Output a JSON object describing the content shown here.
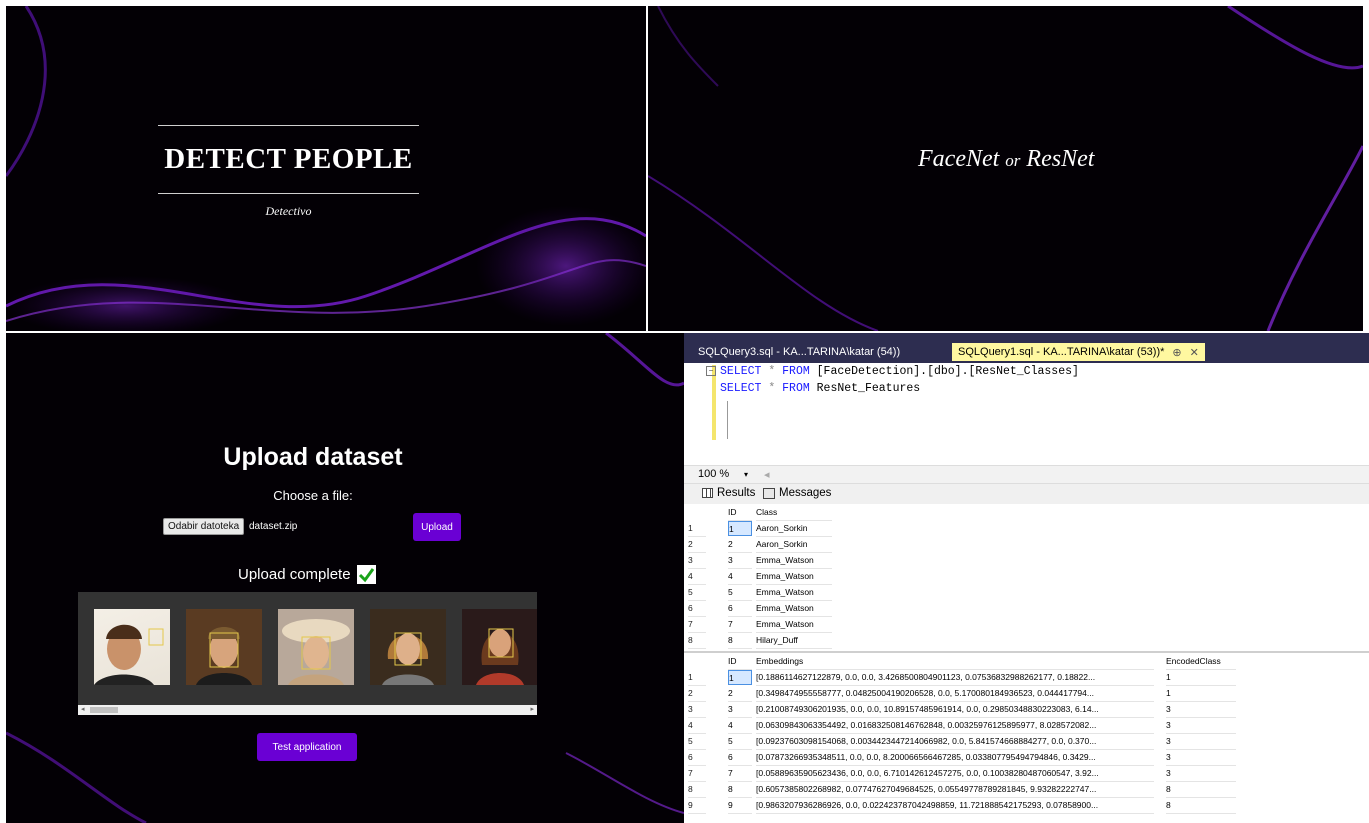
{
  "slide1": {
    "title": "DETECT PEOPLE",
    "subtitle": "Detectivo"
  },
  "slide2": {
    "title_part1": "FaceNet",
    "title_or": "or",
    "title_part2": "ResNet"
  },
  "upload": {
    "title": "Upload dataset",
    "choose_label": "Choose a file:",
    "file_button": "Odabir datoteka",
    "file_name": "dataset.zip",
    "upload_button": "Upload",
    "complete_text": "Upload complete",
    "test_button": "Test application",
    "faces": [
      "face-1",
      "face-2",
      "face-3",
      "face-4",
      "face-5"
    ]
  },
  "ssms": {
    "tab1": "SQLQuery3.sql - KA...TARINA\\katar (54))",
    "tab2": "SQLQuery1.sql - KA...TARINA\\katar (53))*",
    "tab2_pin": "⊕",
    "tab2_close": "✕",
    "code": {
      "line1_kw1": "SELECT",
      "line1_star": " * ",
      "line1_kw2": "FROM",
      "line1_rest": " [FaceDetection].[dbo].[ResNet_Classes]",
      "line2_kw1": "SELECT",
      "line2_star": " * ",
      "line2_kw2": "FROM",
      "line2_rest": " ResNet_Features"
    },
    "zoom": "100 %",
    "results_tab": "Results",
    "messages_tab": "Messages",
    "grid1": {
      "headers": [
        "ID",
        "Class"
      ],
      "rows": [
        [
          "1",
          "1",
          "Aaron_Sorkin"
        ],
        [
          "2",
          "2",
          "Aaron_Sorkin"
        ],
        [
          "3",
          "3",
          "Emma_Watson"
        ],
        [
          "4",
          "4",
          "Emma_Watson"
        ],
        [
          "5",
          "5",
          "Emma_Watson"
        ],
        [
          "6",
          "6",
          "Emma_Watson"
        ],
        [
          "7",
          "7",
          "Emma_Watson"
        ],
        [
          "8",
          "8",
          "Hilary_Duff"
        ]
      ]
    },
    "grid2": {
      "headers": [
        "ID",
        "Embeddings",
        "EncodedClass"
      ],
      "rows": [
        [
          "1",
          "1",
          "[0.1886114627122879, 0.0, 0.0, 3.4268500804901123, 0.07536832988262177, 0.18822...",
          "1"
        ],
        [
          "2",
          "2",
          "[0.3498474955558777, 0.04825004190206528, 0.0, 5.170080184936523, 0.044417794...",
          "1"
        ],
        [
          "3",
          "3",
          "[0.21008749306201935, 0.0, 0.0, 10.89157485961914, 0.0, 0.29850348830223083, 6.14...",
          "3"
        ],
        [
          "4",
          "4",
          "[0.06309843063354492, 0.016832508146762848, 0.00325976125895977, 8.028572082...",
          "3"
        ],
        [
          "5",
          "5",
          "[0.09237603098154068, 0.0034423447214066982, 0.0, 5.841574668884277, 0.0, 0.370...",
          "3"
        ],
        [
          "6",
          "6",
          "[0.07873266935348511, 0.0, 0.0, 8.200066566467285, 0.033807795494794846, 0.3429...",
          "3"
        ],
        [
          "7",
          "7",
          "[0.05889635905623436, 0.0, 0.0, 6.710142612457275, 0.0, 0.10038280487060547, 3.92...",
          "3"
        ],
        [
          "8",
          "8",
          "[0.6057385802268982, 0.07747627049684525, 0.05549778789281845, 9.93282222747...",
          "8"
        ],
        [
          "9",
          "9",
          "[0.9863207936286926, 0.0, 0.022423787042498859, 11.721888542175293, 0.07858900...",
          "8"
        ]
      ]
    }
  },
  "colors": {
    "accent": "#6a00d4",
    "smoke": "#7b1fd6",
    "background": "#030005",
    "tab_active": "#fff8a0"
  }
}
